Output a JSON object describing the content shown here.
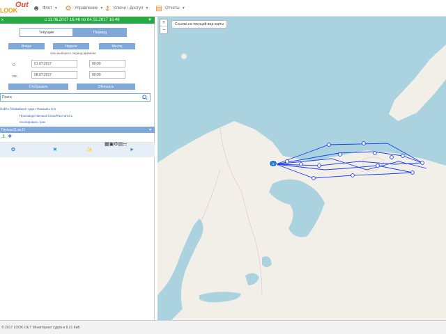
{
  "nav": {
    "logo_look": "LOOK",
    "logo_out": "Out",
    "items": [
      {
        "label": "Флот",
        "icon": "user-icon"
      },
      {
        "label": "Управление",
        "icon": "gear-icon"
      },
      {
        "label": "Ключи / Доступ",
        "icon": "key-icon"
      },
      {
        "label": "Отчеты",
        "icon": "calendar-icon"
      }
    ]
  },
  "period": {
    "close": "x",
    "title": "с 11.06.2017 16:46 по 04.02.2017 16:46"
  },
  "tabs": [
    "Текущие",
    "Период"
  ],
  "quick": [
    "Вчера",
    "Неделя",
    "Месяц"
  ],
  "hint": "Или выберите период времени",
  "from": {
    "label": "С:",
    "date": "01.07.2017",
    "time": "00:00"
  },
  "to": {
    "label": "по:",
    "date": "08.07.2017",
    "time": "00:00"
  },
  "actions": [
    "Отобразить",
    "Обновить"
  ],
  "search": {
    "value": "Поиск"
  },
  "links": [
    "Найти ближайшие суда / Показать все",
    "Производственный план/Рассчитать",
    "Скопировать трек"
  ],
  "group": {
    "title": "Группа (1 из 1)"
  },
  "map": {
    "coord_text": "Ссылка на текущий вид карты"
  },
  "status": {
    "text": "© 2017 LOOK OUT Мониторинг судов и 8,21 КиБ"
  },
  "colors": {
    "green": "#27a844",
    "blue": "#7fa7d8",
    "track": "#1a3cff",
    "sea": "#aad3df",
    "land": "#f2efe9"
  }
}
